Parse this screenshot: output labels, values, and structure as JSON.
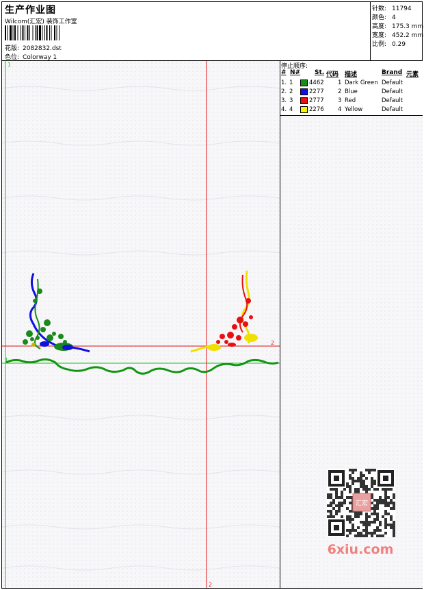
{
  "header": {
    "title": "生产作业图",
    "subtitle": "Wilcom(汇宏) 装饰工作室",
    "design_label": "花版:",
    "design_value": "2082832.dst",
    "colorway_label": "色位:",
    "colorway_value": "Colorway 1"
  },
  "stats": {
    "stitches_label": "针数:",
    "stitches_value": "11794",
    "colors_label": "颜色:",
    "colors_value": "4",
    "height_label": "高度:",
    "height_value": "175.3 mm",
    "width_label": "宽度:",
    "width_value": "452.2 mm",
    "scale_label": "比例:",
    "scale_value": "0.29"
  },
  "stop_sequence": {
    "title": "停止顺序:",
    "columns": [
      "#",
      "N#",
      "St.",
      "代码",
      "描述",
      "Brand",
      "元素"
    ],
    "rows": [
      {
        "idx": "1.",
        "n": "1",
        "stitches": "4462",
        "code": "1",
        "desc": "Dark Green",
        "brand": "Default",
        "color": "#1a8a1a"
      },
      {
        "idx": "2.",
        "n": "2",
        "stitches": "2277",
        "code": "2",
        "desc": "Blue",
        "brand": "Default",
        "color": "#1010e0"
      },
      {
        "idx": "3.",
        "n": "3",
        "stitches": "2777",
        "code": "3",
        "desc": "Red",
        "brand": "Default",
        "color": "#e81010"
      },
      {
        "idx": "4.",
        "n": "4",
        "stitches": "2276",
        "code": "4",
        "desc": "Yellow",
        "brand": "Default",
        "color": "#f5f500"
      }
    ]
  },
  "canvas": {
    "guide_label_v1": "1",
    "guide_label_h1": "1",
    "guide_label_v2": "2",
    "guide_label_h2": "2",
    "green_guide_color": "#19c019",
    "red_guide_color": "#e01010"
  },
  "watermark": {
    "site": "6xiu.com",
    "stamp": "汇宏"
  }
}
